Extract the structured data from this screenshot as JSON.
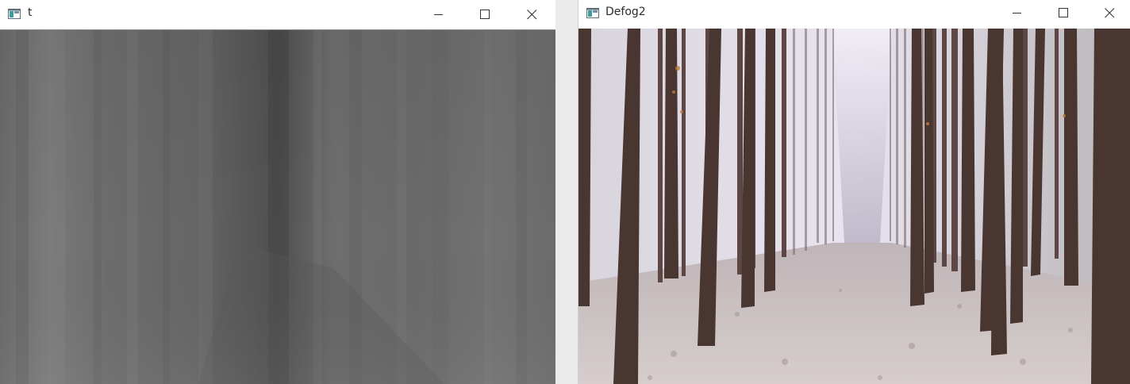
{
  "windows": [
    {
      "title": "t",
      "icon": "opencv-window-icon",
      "controls": [
        "minimize-icon",
        "maximize-icon",
        "close-icon"
      ],
      "content": "grayscale-transmission-map"
    },
    {
      "title": "Defog2",
      "icon": "opencv-window-icon",
      "controls": [
        "minimize-icon",
        "maximize-icon",
        "close-icon"
      ],
      "content": "dehazed-forest-photo"
    }
  ],
  "colors": {
    "titlebar_bg": "#ffffff",
    "desktop_bg": "#ebebeb",
    "transmission_gray": "#6e6e6e",
    "trunk_brown": "#4a3630",
    "leaf_ground": "#cfc6c4",
    "fog_sky": "#e8e6ee"
  }
}
